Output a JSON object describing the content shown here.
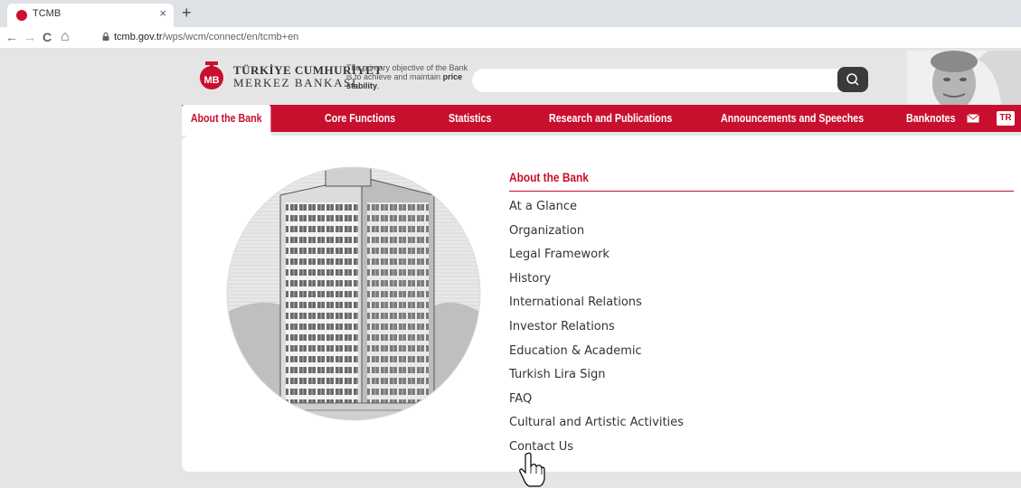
{
  "browser": {
    "tab_title": "TCMB",
    "tab_close": "×",
    "new_tab": "+",
    "url_host": "tcmb.gov.tr",
    "url_path": "/wps/wcm/connect/en/tcmb+en",
    "back": "←",
    "forward": "→",
    "reload": "C",
    "home": "⌂"
  },
  "header": {
    "brand_line1": "TÜRKİYE CUMHURİYET",
    "brand_line2": "MERKEZ BANKASI",
    "tagline_1": "The primary objective of the Bank",
    "tagline_2": "is to achieve and maintain",
    "tagline_bold_1": "price",
    "tagline_bold_2": "stability",
    "tagline_end": ".",
    "search_placeholder": ""
  },
  "nav": {
    "items": [
      {
        "label": "About the Bank"
      },
      {
        "label": "Core Functions"
      },
      {
        "label": "Statistics"
      },
      {
        "label": "Research and Publications"
      },
      {
        "label": "Announcements and Speeches"
      },
      {
        "label": "Banknotes"
      }
    ],
    "lang": "TR"
  },
  "menu": {
    "heading": "About the Bank",
    "items": [
      "At a Glance",
      "Organization",
      "Legal Framework",
      "History",
      "International Relations",
      "Investor Relations",
      "Education & Academic",
      "Turkish Lira Sign",
      "FAQ",
      "Cultural and Artistic Activities",
      "Contact Us"
    ]
  },
  "colors": {
    "brand_red": "#c8102e",
    "page_grey": "#e5e5e5",
    "search_button": "#3a3a3a"
  }
}
